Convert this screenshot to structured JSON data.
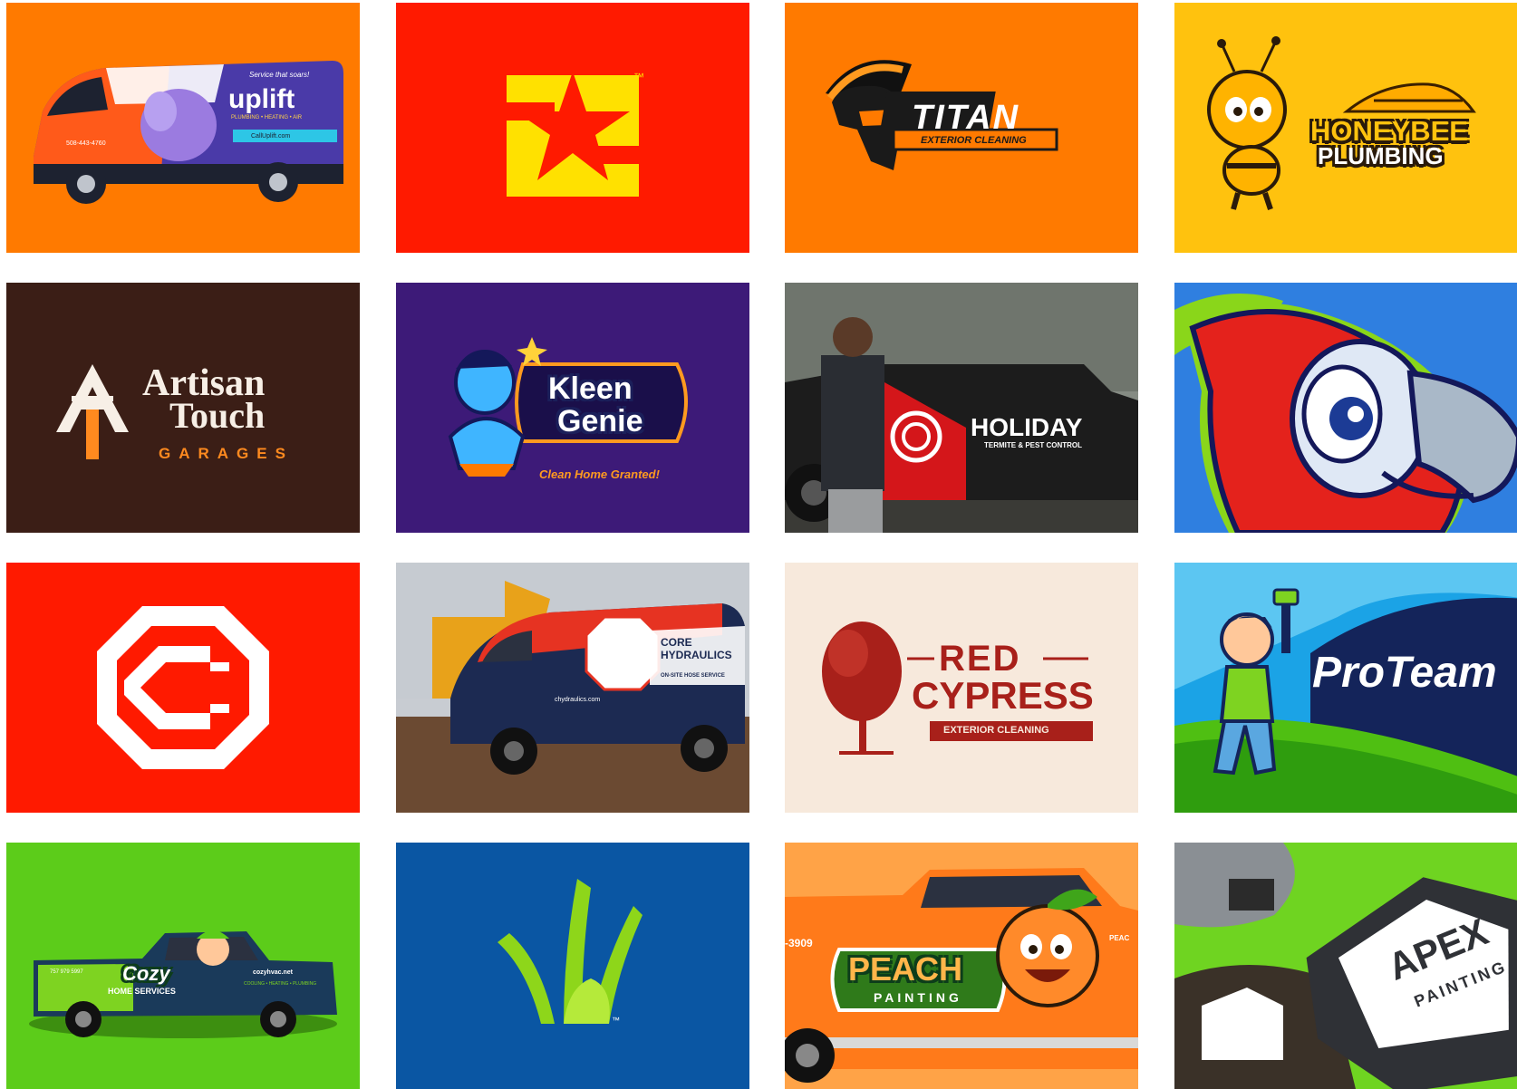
{
  "colors": {
    "orange": "#ff7a00",
    "red": "#ff1a00",
    "yellow": "#ffc20e",
    "brown": "#3b1e16",
    "purple": "#3d1a78",
    "blue": "#0a56a3",
    "green": "#4fbf12",
    "cream": "#f7e9dc"
  },
  "tiles": {
    "uplift": {
      "tagline": "Service that soars!",
      "brand": "uplift",
      "services": "PLUMBING • HEATING • AIR",
      "phone": "508-443-4760",
      "web": "CallUplift.com"
    },
    "s_logo": {
      "tm": "™"
    },
    "titan": {
      "name": "TITAN",
      "sub": "EXTERIOR CLEANING"
    },
    "honeybee": {
      "line1": "HONEYBEE",
      "line2": "PLUMBING"
    },
    "artisan": {
      "line1": "Artisan",
      "line2": "Touch",
      "line3": "GARAGES"
    },
    "kleen": {
      "line1": "Kleen",
      "line2": "Genie",
      "tagline": "Clean Home Granted!"
    },
    "holiday": {
      "name": "HOLIDAY",
      "sub": "TERMITE & PEST CONTROL"
    },
    "parrot": {},
    "c_logo": {},
    "core": {
      "line1": "CORE",
      "line2": "HYDRAULICS",
      "service": "ON-SITE HOSE SERVICE",
      "web": "chydraulics.com"
    },
    "red_cypress": {
      "line1": "RED",
      "line2": "CYPRESS",
      "sub": "EXTERIOR CLEANING"
    },
    "proteam": {
      "name": "ProTeam"
    },
    "cozy": {
      "brand": "Cozy",
      "sub": "HOME SERVICES",
      "web": "cozyhvac.net",
      "services": "COOLING • HEATING • PLUMBING",
      "phone": "757 979 5997"
    },
    "n_logo": {
      "tm": "™"
    },
    "peach": {
      "line1": "PEACH",
      "line2": "PAINTING",
      "phone": "-3909",
      "edge": "PEAC"
    },
    "apex": {
      "line1": "APEX",
      "line2": "PAINTING"
    }
  }
}
